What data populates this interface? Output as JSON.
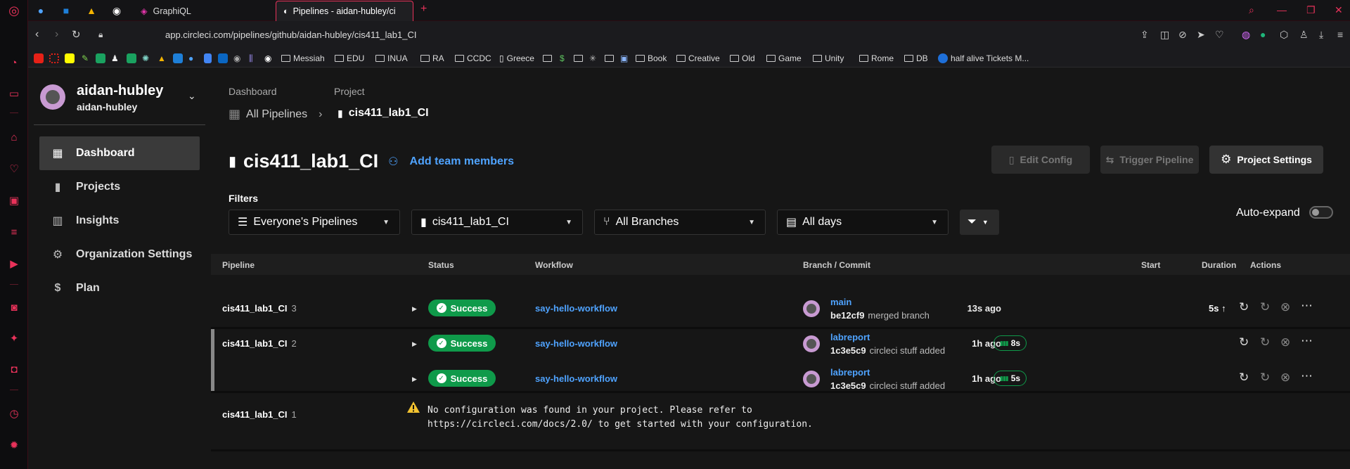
{
  "browser": {
    "tabs": [
      {
        "title": "GraphiQL"
      },
      {
        "title": "Pipelines - aidan-hubley/ci"
      }
    ],
    "url": "app.circleci.com/pipelines/github/aidan-hubley/cis411_lab1_CI",
    "bookmarks": [
      "Messiah",
      "EDU",
      "INUA",
      "RA",
      "CCDC",
      "Greece",
      "Book",
      "Creative",
      "Old",
      "Game",
      "Unity",
      "Rome",
      "DB",
      "half alive Tickets M..."
    ],
    "accent_color": "#e8325a"
  },
  "sidebar": {
    "org_name": "aidan-hubley",
    "org_sub": "aidan-hubley",
    "items": [
      {
        "label": "Dashboard",
        "icon": "dashboard-icon",
        "selected": true
      },
      {
        "label": "Projects",
        "icon": "bookmark-icon"
      },
      {
        "label": "Insights",
        "icon": "bar-chart-icon"
      },
      {
        "label": "Organization Settings",
        "icon": "gear-icon"
      },
      {
        "label": "Plan",
        "icon": "dollar-icon"
      }
    ]
  },
  "breadcrumb": {
    "dashboard_label": "Dashboard",
    "dashboard_value": "All Pipelines",
    "project_label": "Project",
    "project_value": "cis411_lab1_CI"
  },
  "header": {
    "title": "cis411_lab1_CI",
    "add_team": "Add team members",
    "edit_config": "Edit Config",
    "trigger_pipeline": "Trigger Pipeline",
    "project_settings": "Project Settings"
  },
  "filters": {
    "label": "Filters",
    "pipelines": "Everyone's Pipelines",
    "project": "cis411_lab1_CI",
    "branches": "All Branches",
    "days": "All days",
    "auto_expand": "Auto-expand"
  },
  "table": {
    "headers": {
      "pipeline": "Pipeline",
      "status": "Status",
      "workflow": "Workflow",
      "branch_commit": "Branch / Commit",
      "start": "Start",
      "duration": "Duration",
      "actions": "Actions"
    },
    "rows": [
      {
        "pipeline": "cis411_lab1_CI",
        "number": "3",
        "status": "Success",
        "workflow": "say-hello-workflow",
        "branch": "main",
        "commit": "be12cf9",
        "message": "merged branch",
        "start": "13s ago",
        "duration": "5s"
      },
      {
        "pipeline": "cis411_lab1_CI",
        "number": "2",
        "status": "Success",
        "workflow": "say-hello-workflow",
        "branch": "labreport",
        "commit": "1c3e5c9",
        "message": "circleci stuff added",
        "start": "1h ago",
        "duration": "8s"
      },
      {
        "pipeline": "",
        "number": "",
        "status": "Success",
        "workflow": "say-hello-workflow",
        "branch": "labreport",
        "commit": "1c3e5c9",
        "message": "circleci stuff added",
        "start": "1h ago",
        "duration": "5s"
      },
      {
        "pipeline": "cis411_lab1_CI",
        "number": "1"
      }
    ],
    "no_config_line1": "No configuration was found in your project. Please refer to",
    "no_config_line2": "https://circleci.com/docs/2.0/ to get started with your configuration."
  }
}
